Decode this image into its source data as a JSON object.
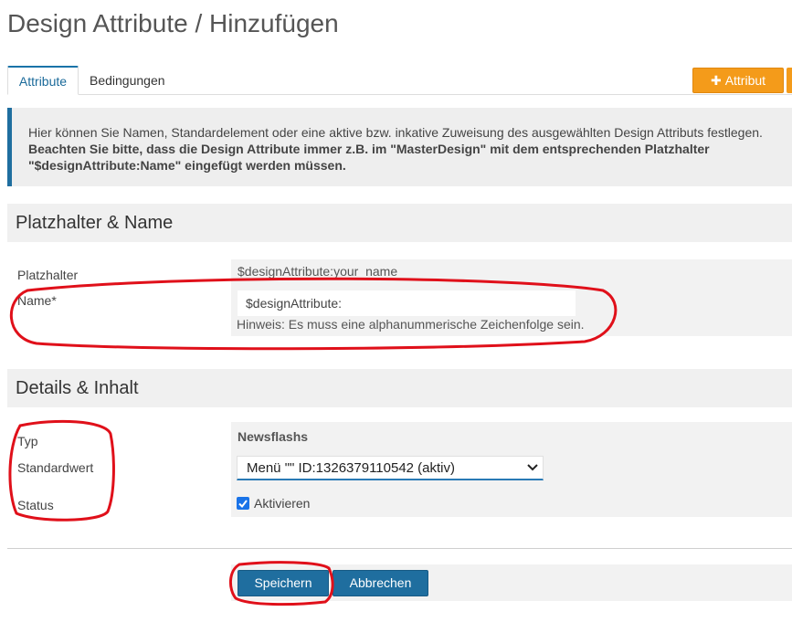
{
  "page": {
    "title": "Design Attribute / Hinzufügen"
  },
  "tabs": [
    {
      "label": "Attribute",
      "active": true
    },
    {
      "label": "Bedingungen",
      "active": false
    }
  ],
  "toolbar": {
    "add_attribute_label": "Attribut",
    "add_icon": "plus-icon"
  },
  "info": {
    "line1": "Hier können Sie Namen, Standardelement oder eine aktive bzw. inkative Zuweisung des ausgewählten Design Attributs festlegen.",
    "line2": "Beachten Sie bitte, dass die Design Attribute immer z.B. im \"MasterDesign\" mit dem entsprechenden Platzhalter",
    "line3": "\"$designAttribute:Name\" eingefügt werden müssen."
  },
  "section_placeholder": {
    "heading": "Platzhalter & Name",
    "placeholder_label": "Platzhalter",
    "placeholder_value": "$designAttribute:your_name",
    "name_label": "Name*",
    "name_value": "$designAttribute:",
    "name_hint": "Hinweis: Es muss eine alphanummerische Zeichenfolge sein."
  },
  "section_details": {
    "heading": "Details & Inhalt",
    "type_label": "Typ",
    "type_value": "Newsflashs",
    "default_label": "Standardwert",
    "default_value": "Menü \"\" ID:1326379110542 (aktiv)",
    "status_label": "Status",
    "status_checkbox_label": "Aktivieren",
    "status_checked": true
  },
  "actions": {
    "save_label": "Speichern",
    "cancel_label": "Abbrechen"
  },
  "colors": {
    "accent": "#1f6e9f",
    "orange": "#f49b1a",
    "annotation": "#e0101a"
  }
}
